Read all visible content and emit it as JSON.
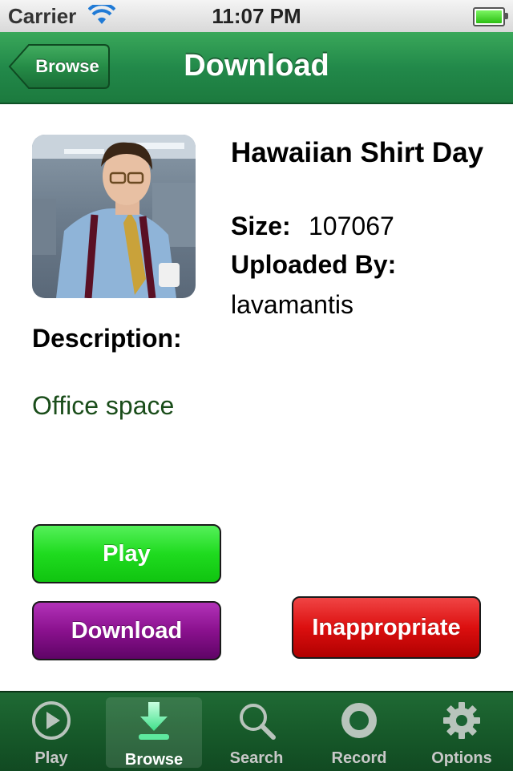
{
  "status_bar": {
    "carrier": "Carrier",
    "time": "11:07 PM"
  },
  "nav": {
    "back_label": "Browse",
    "title": "Download"
  },
  "item": {
    "title": "Hawaiian Shirt Day",
    "size_label": "Size:",
    "size_value": "107067",
    "uploaded_label": "Uploaded By:",
    "uploaded_value": "lavamantis",
    "description_label": "Description:",
    "description_value": "Office space"
  },
  "buttons": {
    "play": "Play",
    "download": "Download",
    "inappropriate": "Inappropriate"
  },
  "tabs": [
    {
      "label": "Play",
      "icon": "play-icon"
    },
    {
      "label": "Browse",
      "icon": "download-arrow-icon",
      "selected": true
    },
    {
      "label": "Search",
      "icon": "search-icon"
    },
    {
      "label": "Record",
      "icon": "record-icon"
    },
    {
      "label": "Options",
      "icon": "gear-icon"
    }
  ],
  "colors": {
    "nav_green": "#22894a",
    "play_green": "#1fdb1f",
    "download_purple": "#8a118e",
    "inappropriate_red": "#dc0f0f",
    "description_text": "#1a4d1a"
  }
}
